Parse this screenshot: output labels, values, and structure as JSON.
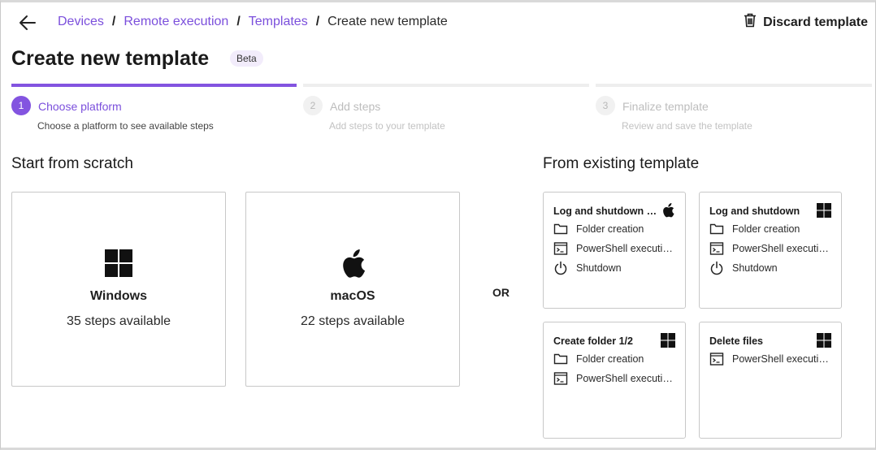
{
  "breadcrumb": {
    "items": [
      "Devices",
      "Remote execution",
      "Templates"
    ],
    "separator": "/",
    "current": "Create new template"
  },
  "header": {
    "discard_label": "Discard template",
    "title": "Create new template",
    "badge": "Beta"
  },
  "stepper": [
    {
      "num": "1",
      "title": "Choose platform",
      "subtitle": "Choose a platform to see available steps",
      "active": true
    },
    {
      "num": "2",
      "title": "Add steps",
      "subtitle": "Add steps to your template",
      "active": false
    },
    {
      "num": "3",
      "title": "Finalize template",
      "subtitle": "Review and save the template",
      "active": false
    }
  ],
  "scratch": {
    "heading": "Start from scratch",
    "platforms": [
      {
        "name": "Windows",
        "steps": "35 steps available",
        "icon": "windows-icon"
      },
      {
        "name": "macOS",
        "steps": "22 steps available",
        "icon": "apple-icon"
      }
    ]
  },
  "or_label": "OR",
  "existing": {
    "heading": "From existing template",
    "templates": [
      {
        "title": "Log and shutdown o...",
        "os": "apple-icon",
        "steps": [
          {
            "icon": "folder-icon",
            "label": "Folder creation"
          },
          {
            "icon": "terminal-icon",
            "label": "PowerShell execution..."
          },
          {
            "icon": "power-icon",
            "label": "Shutdown"
          }
        ]
      },
      {
        "title": "Log and shutdown",
        "os": "windows-icon",
        "steps": [
          {
            "icon": "folder-icon",
            "label": "Folder creation"
          },
          {
            "icon": "terminal-icon",
            "label": "PowerShell execution..."
          },
          {
            "icon": "power-icon",
            "label": "Shutdown"
          }
        ]
      },
      {
        "title": "Create folder 1/2",
        "os": "windows-icon",
        "steps": [
          {
            "icon": "folder-icon",
            "label": "Folder creation"
          },
          {
            "icon": "terminal-icon",
            "label": "PowerShell execution..."
          }
        ]
      },
      {
        "title": "Delete files",
        "os": "windows-icon",
        "steps": [
          {
            "icon": "terminal-icon",
            "label": "PowerShell execution..."
          }
        ]
      }
    ]
  },
  "colors": {
    "accent": "#7b4fdc",
    "inactive": "#bdbdbd",
    "track": "#eeeeee"
  }
}
